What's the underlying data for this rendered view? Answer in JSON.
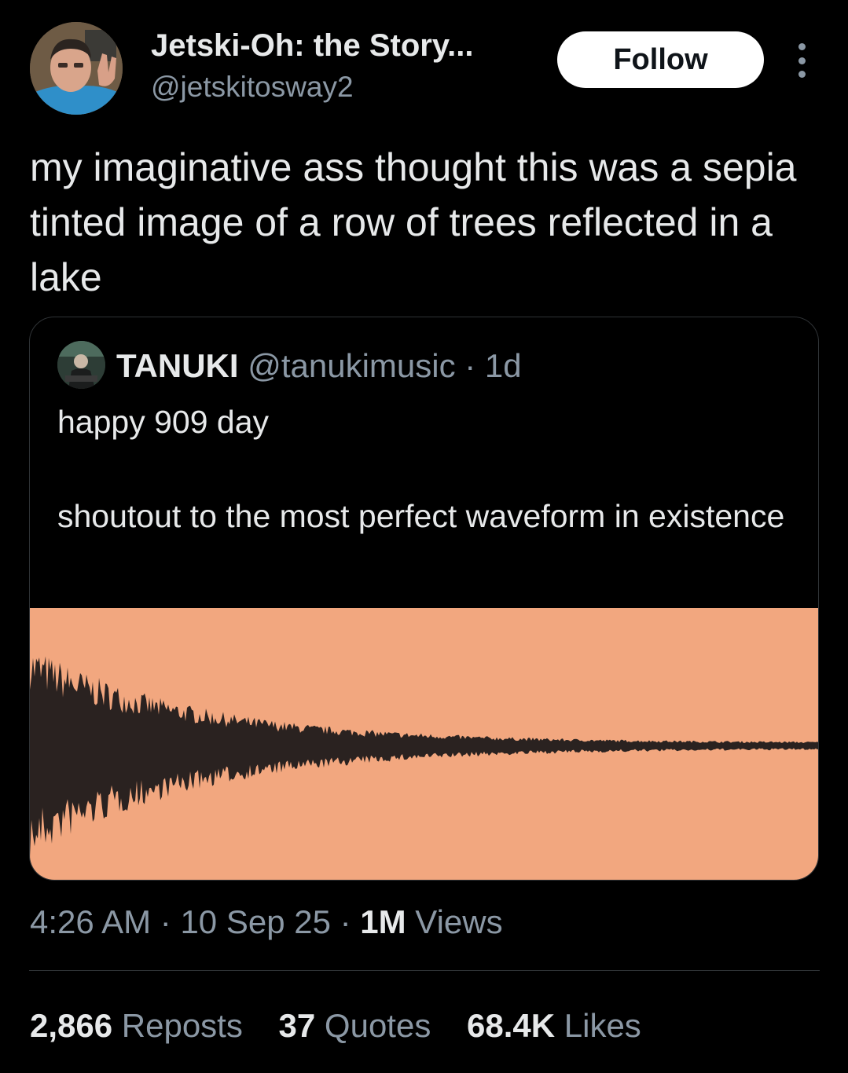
{
  "author": {
    "name": "Jetski-Oh: the Story...",
    "handle": "@jetskitosway2"
  },
  "follow_label": "Follow",
  "more_icon": "more-options-icon",
  "tweet_text": "my imaginative ass thought this was a sepia tinted image of a row of trees reflected in a lake",
  "quoted": {
    "name": "TANUKI",
    "handle": "@tanukimusic",
    "separator": " · ",
    "age": "1d",
    "text": "happy 909 day\n\nshoutout to the most perfect waveform in existence",
    "media": {
      "type": "waveform-image",
      "background": "#f2a77f",
      "waveform_color": "#2a2220"
    }
  },
  "meta": {
    "time": "4:26 AM",
    "sep1": " · ",
    "date": "10 Sep 25",
    "sep2": " · ",
    "views_count": "1M",
    "views_label": " Views"
  },
  "stats": [
    {
      "count": "2,866",
      "label": " Reposts"
    },
    {
      "count": "37",
      "label": " Quotes"
    },
    {
      "count": "68.4K",
      "label": " Likes"
    }
  ],
  "colors": {
    "background": "#000000",
    "text_primary": "#e7e9ea",
    "text_secondary": "#8b98a5",
    "border": "#2f3336"
  }
}
